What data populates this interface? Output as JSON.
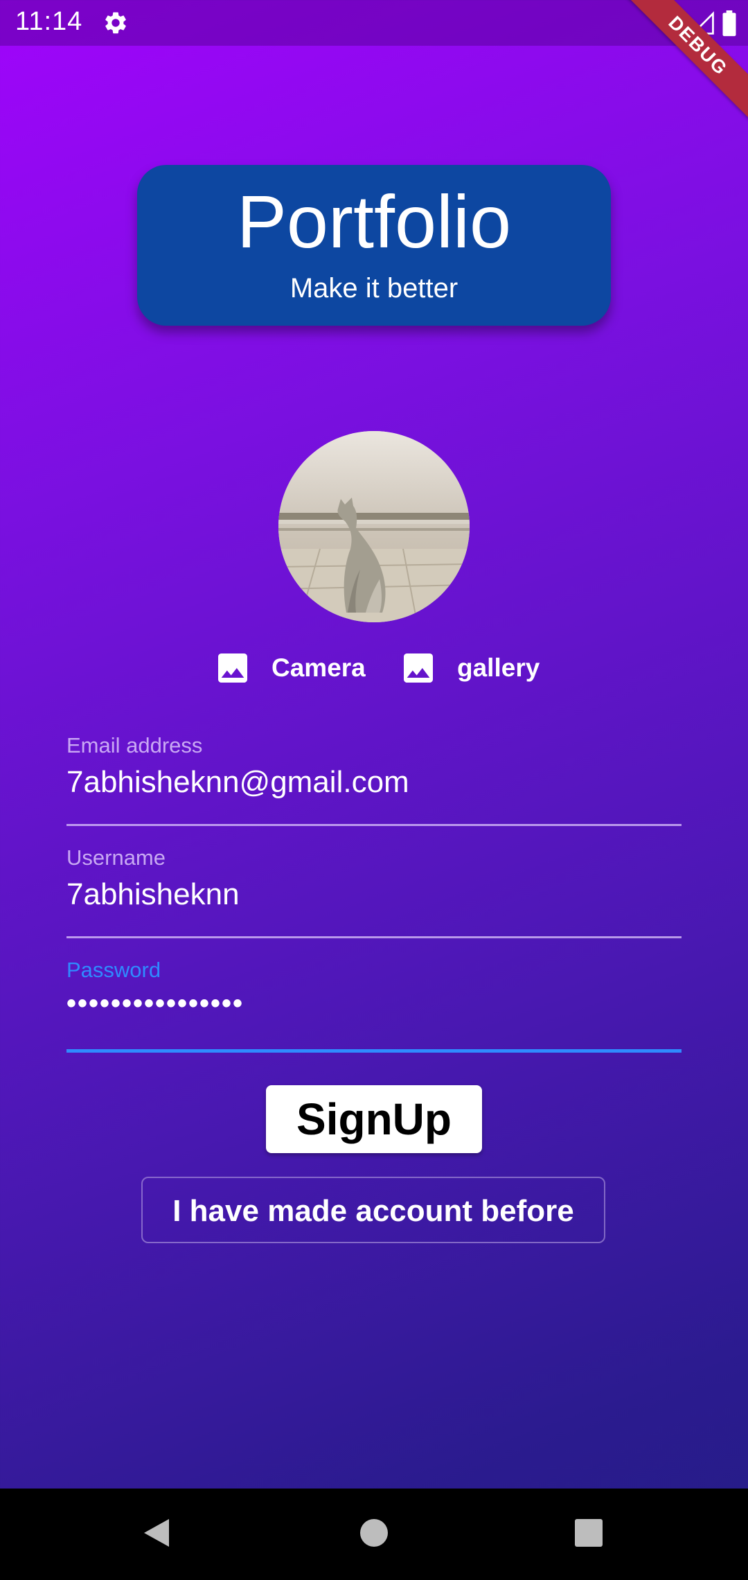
{
  "status_bar": {
    "time": "11:14"
  },
  "debug_banner": "DEBUG",
  "header": {
    "title": "Portfolio",
    "subtitle": "Make it better"
  },
  "photo_sources": {
    "camera_label": "Camera",
    "gallery_label": "gallery"
  },
  "form": {
    "email": {
      "label": "Email address",
      "value": "7abhisheknn@gmail.com"
    },
    "username": {
      "label": "Username",
      "value": "7abhisheknn"
    },
    "password": {
      "label": "Password",
      "value": "••••••••••••••••"
    }
  },
  "buttons": {
    "signup": "SignUp",
    "existing_account": "I have made account before"
  },
  "colors": {
    "background_top": "#a004fb",
    "background_bottom": "#241c86",
    "header_card": "#0d47a1",
    "focus_accent": "#2f8bff",
    "debug_ribbon": "#b32b3d"
  }
}
